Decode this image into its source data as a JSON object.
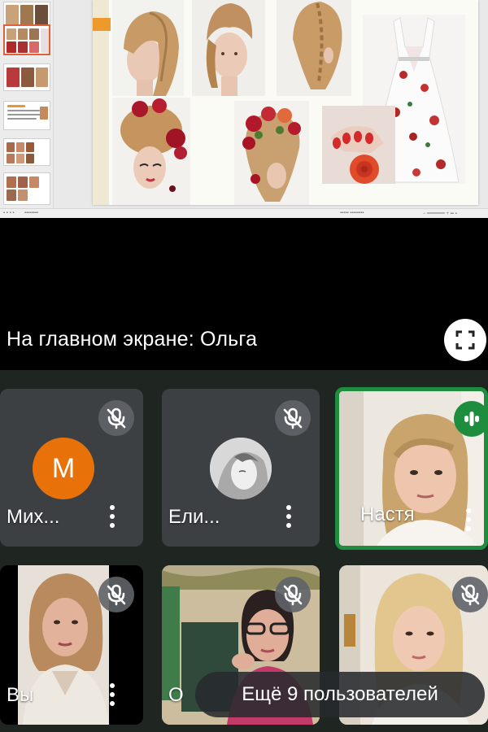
{
  "main_screen": {
    "label": "На главном экране: Ольга"
  },
  "participants": [
    {
      "name": "Мих...",
      "avatar_letter": "М",
      "avatar_color": "#e8710a",
      "muted": true
    },
    {
      "name": "Ели...",
      "avatar": "photo",
      "muted": true
    },
    {
      "name": "Настя",
      "video": true,
      "speaking": true
    },
    {
      "name": "Вы",
      "video": true,
      "muted": true
    },
    {
      "name": "О",
      "video": true,
      "muted": true
    },
    {
      "name": "",
      "video": true,
      "muted": true
    }
  ],
  "more_users_label": "Ещё 9 пользователей",
  "icons": {
    "mute": "mic-off-icon",
    "speaking": "audio-levels-icon",
    "more": "more-vert-icon",
    "fullscreen": "fullscreen-icon"
  },
  "colors": {
    "speaking_border": "#1e8e3e",
    "tile_bg": "#3c4043",
    "grid_bg": "#1f2621"
  }
}
